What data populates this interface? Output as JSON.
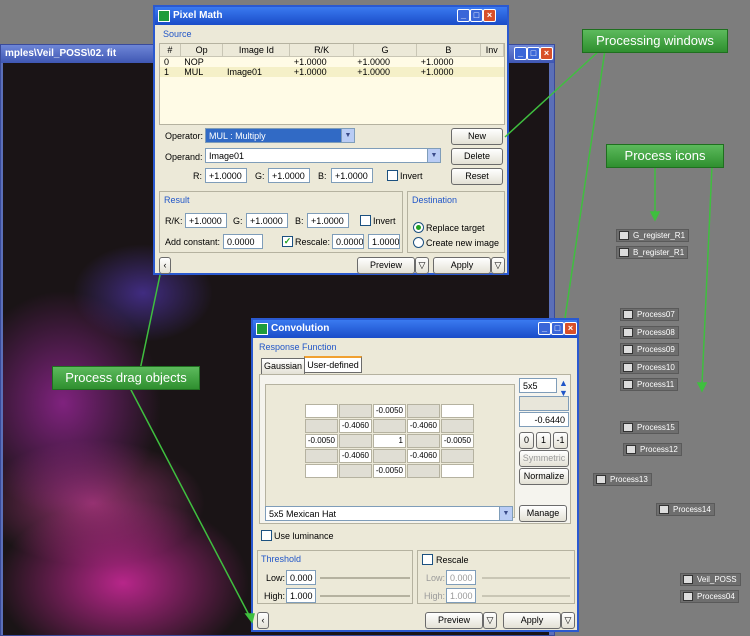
{
  "image_window": {
    "title": "mples\\Veil_POSS\\02. fit"
  },
  "pixel_math": {
    "title": "Pixel Math",
    "source_label": "Source",
    "columns": [
      "#",
      "Op",
      "Image Id",
      "R/K",
      "G",
      "B",
      "Inv"
    ],
    "rows": [
      {
        "n": "0",
        "op": "NOP",
        "id": "",
        "r": "+1.0000",
        "g": "+1.0000",
        "b": "+1.0000"
      },
      {
        "n": "1",
        "op": "MUL",
        "id": "Image01",
        "r": "+1.0000",
        "g": "+1.0000",
        "b": "+1.0000"
      }
    ],
    "operator_label": "Operator:",
    "operator_value": "MUL : Multiply",
    "operand_label": "Operand:",
    "operand_value": "Image01",
    "r_label": "R:",
    "r_value": "+1.0000",
    "g_label": "G:",
    "g_value": "+1.0000",
    "b_label": "B:",
    "b_value": "+1.0000",
    "invert_label": "Invert",
    "new_label": "New",
    "delete_label": "Delete",
    "reset_label": "Reset",
    "result_label": "Result",
    "rk_label": "R/K:",
    "res_r": "+1.0000",
    "res_g": "+1.0000",
    "res_b": "+1.0000",
    "add_constant_label": "Add constant:",
    "add_constant": "0.0000",
    "rescale_label": "Rescale:",
    "rescale_low": "0.0000",
    "rescale_high": "1.0000",
    "destination_label": "Destination",
    "replace_label": "Replace target",
    "create_label": "Create new image",
    "preview_label": "Preview",
    "apply_label": "Apply"
  },
  "convolution": {
    "title": "Convolution",
    "response_label": "Response Function",
    "tab_gaussian": "Gaussian",
    "tab_user": "User-defined",
    "size": "5x5",
    "center_value": "-0.6440",
    "btn0": "0",
    "btn1": "1",
    "btnm1": "-1",
    "symmetric_label": "Symmetric",
    "normalize_label": "Normalize",
    "kernel": [
      [
        "",
        "",
        "-0.0050",
        "",
        ""
      ],
      [
        "",
        "-0.4060",
        "",
        "-0.4060",
        ""
      ],
      [
        "-0.0050",
        "",
        "1",
        "",
        "-0.0050"
      ],
      [
        "",
        "-0.4060",
        "",
        "-0.4060",
        ""
      ],
      [
        "",
        "",
        "-0.0050",
        "",
        ""
      ]
    ],
    "filter_value": "5x5 Mexican Hat",
    "manage_label": "Manage",
    "use_luminance_label": "Use luminance",
    "threshold_label": "Threshold",
    "low_label": "Low:",
    "low_value": "0.000",
    "high_label": "High:",
    "high_value": "1.000",
    "rescale_label": "Rescale",
    "r_low_label": "Low:",
    "r_low_value": "0.000",
    "r_high_label": "High:",
    "r_high_value": "1.000",
    "preview_label": "Preview",
    "apply_label": "Apply"
  },
  "callouts": {
    "processing_windows": "Processing windows",
    "process_icons": "Process icons",
    "process_drag_objects": "Process drag objects"
  },
  "icons": [
    "G_register_R1",
    "B_register_R1",
    "Process07",
    "Process08",
    "Process09",
    "Process10",
    "Process11",
    "Process15",
    "Process12",
    "Process13",
    "Process14",
    "Veil_POSS",
    "Process04"
  ]
}
